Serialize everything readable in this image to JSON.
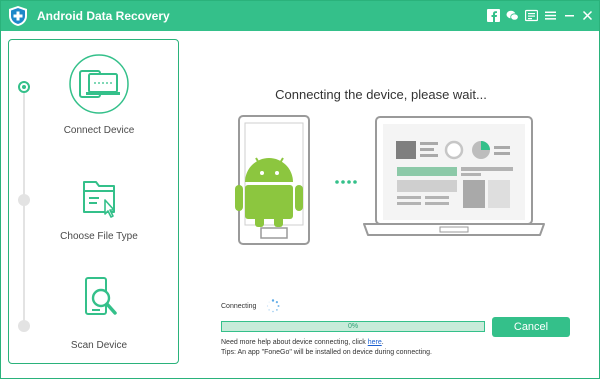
{
  "window": {
    "title": "Android Data Recovery",
    "toolbar_icons": [
      "facebook-icon",
      "chat-icon",
      "feedback-icon",
      "menu-icon",
      "minimize-icon",
      "close-icon"
    ]
  },
  "sidebar": {
    "steps": [
      {
        "label": "Connect Device",
        "icon": "connect-device-icon",
        "active": true
      },
      {
        "label": "Choose File Type",
        "icon": "choose-file-type-icon",
        "active": false
      },
      {
        "label": "Scan Device",
        "icon": "scan-device-icon",
        "active": false
      }
    ]
  },
  "main": {
    "heading": "Connecting the device, please wait...",
    "connecting_label": "Connecting",
    "progress_percent": 0,
    "progress_text": "0%",
    "cancel_label": "Cancel",
    "help_prefix": "Need more help about device connecting, click ",
    "help_link": "here",
    "help_suffix": ".",
    "tips": "Tips: An app \"FoneGo\" will be installed on device during connecting."
  },
  "colors": {
    "accent": "#34c08a",
    "android_green": "#8cc63f",
    "link": "#1a5fd0"
  }
}
